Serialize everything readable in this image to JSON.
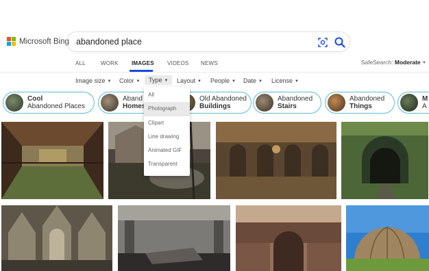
{
  "brand": {
    "name": "Microsoft Bing",
    "logo_colors": [
      "#f25022",
      "#7fba00",
      "#00a4ef",
      "#ffb900"
    ]
  },
  "search": {
    "query": "abandoned place",
    "visual_search_icon": "camera-scan-icon",
    "search_icon": "magnifier-icon",
    "accent": "#174ae4"
  },
  "nav": {
    "tabs": [
      "ALL",
      "WORK",
      "IMAGES",
      "VIDEOS",
      "NEWS"
    ],
    "active": "IMAGES",
    "safesearch_label": "SafeSearch:",
    "safesearch_value": "Moderate"
  },
  "filters": [
    "Image size",
    "Color",
    "Type",
    "Layout",
    "People",
    "Date",
    "License"
  ],
  "type_dropdown": {
    "options": [
      "All",
      "Photograph",
      "Clipart",
      "Line drawing",
      "Animated GIF",
      "Transparent"
    ],
    "highlighted": "Photograph"
  },
  "chips": [
    {
      "line1": "Cool",
      "line2": "Abandoned Places",
      "bold_line": 1
    },
    {
      "line1": "Aband",
      "line2": "Homes",
      "bold_line": 2
    },
    {
      "line1": "Old Abandoned",
      "line2": "Buildings",
      "bold_line": 2
    },
    {
      "line1": "Abandoned",
      "line2": "Stairs",
      "bold_line": 2
    },
    {
      "line1": "Abandoned",
      "line2": "Things",
      "bold_line": 2
    },
    {
      "line1": "M",
      "line2": "A",
      "bold_line": 1
    }
  ],
  "chip_border_color": "#5bbcd6",
  "results": [
    {
      "name": "result-hall-pool",
      "colors": [
        "#3d2a1c",
        "#6c4a2f",
        "#8a7b55",
        "#5e6e3b"
      ]
    },
    {
      "name": "result-forest-house-car",
      "colors": [
        "#4a443c",
        "#7a6f60",
        "#3b3a2c",
        "#9a9284"
      ]
    },
    {
      "name": "result-arched-ballroom",
      "colors": [
        "#5a4630",
        "#8a6a45",
        "#c39a60",
        "#3c2e20"
      ]
    },
    {
      "name": "result-railway-tunnel",
      "colors": [
        "#2b3a26",
        "#4c6638",
        "#6e8a4a",
        "#141810"
      ]
    },
    {
      "name": "result-gothic-church",
      "colors": [
        "#5e5749",
        "#8f8671",
        "#bdb29a",
        "#3d3830"
      ]
    },
    {
      "name": "result-ruined-hall",
      "colors": [
        "#4f4d49",
        "#7c7a76",
        "#a5a29b",
        "#2e2c2a"
      ]
    },
    {
      "name": "result-theatre",
      "colors": [
        "#6a4a3a",
        "#94705a",
        "#c5a98e",
        "#3e2a20"
      ]
    },
    {
      "name": "result-dome",
      "colors": [
        "#2f7fd1",
        "#66a8e6",
        "#a08660",
        "#6d9a3b"
      ]
    }
  ]
}
